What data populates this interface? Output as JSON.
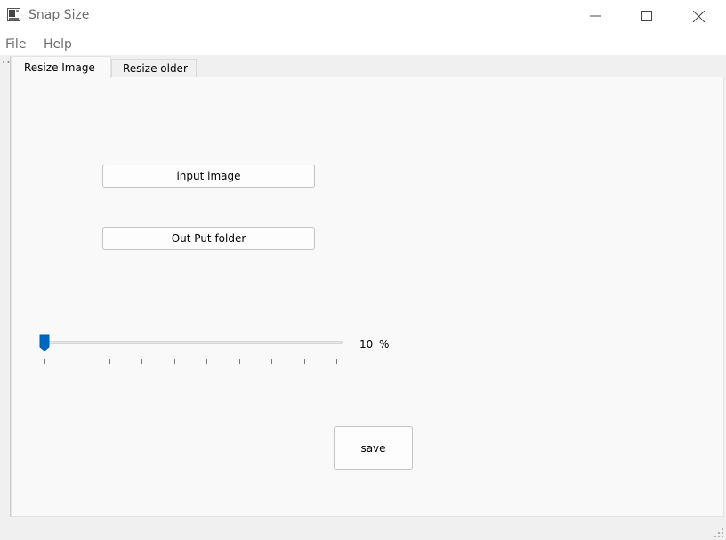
{
  "window": {
    "title": "Snap Size",
    "icon": "app-image-icon",
    "controls": [
      "minimize-icon",
      "maximize-icon",
      "close-icon"
    ]
  },
  "menu": {
    "items": [
      {
        "label": "File"
      },
      {
        "label": "Help"
      }
    ]
  },
  "tabs": [
    {
      "label": "Resize Image",
      "active": true
    },
    {
      "label": "Resize older",
      "active": false
    }
  ],
  "panel": {
    "input_button": "input image",
    "output_button": "Out Put folder",
    "slider": {
      "value": 10,
      "value_text": "10",
      "unit": "%",
      "min": 10,
      "max": 100,
      "tick_count": 10
    },
    "save_button": "save"
  },
  "colors": {
    "accent": "#0067c0",
    "window_bg": "#f0f0f0",
    "panel_bg": "#f9f9f9"
  }
}
